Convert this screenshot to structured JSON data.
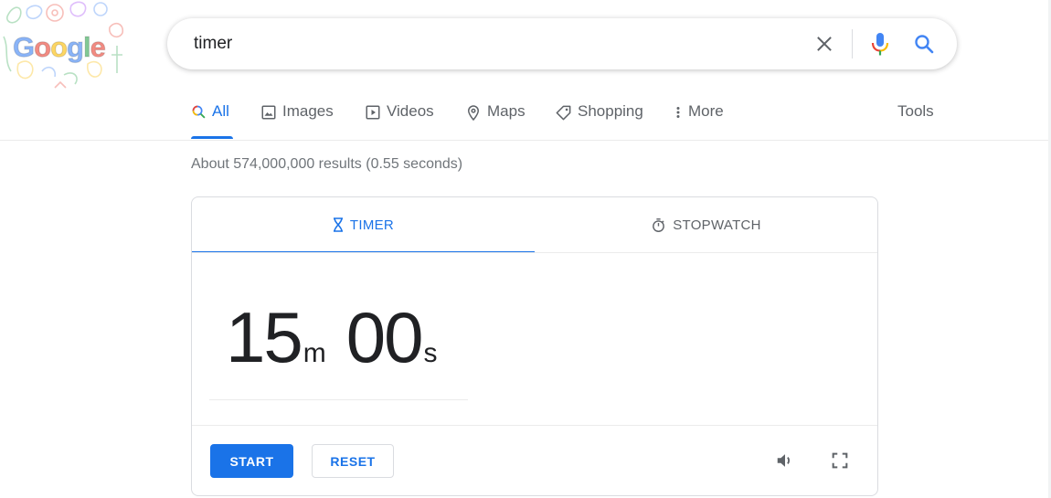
{
  "logo": {
    "letters": [
      "G",
      "o",
      "o",
      "g",
      "l",
      "e"
    ]
  },
  "search": {
    "value": "timer",
    "placeholder": ""
  },
  "icons": {
    "clear": "close-icon",
    "mic": "mic-icon",
    "search": "search-icon",
    "tab_all": "search-icon",
    "tab_images": "image-icon",
    "tab_videos": "play-icon",
    "tab_maps": "map-pin-icon",
    "tab_shopping": "tag-icon",
    "tab_more": "kebab-icon",
    "timer": "hourglass-icon",
    "stopwatch": "stopwatch-icon",
    "volume": "volume-icon",
    "fullscreen": "fullscreen-icon"
  },
  "nav": {
    "tabs": [
      {
        "label": "All",
        "active": true
      },
      {
        "label": "Images"
      },
      {
        "label": "Videos"
      },
      {
        "label": "Maps"
      },
      {
        "label": "Shopping"
      },
      {
        "label": "More"
      }
    ],
    "tools": "Tools"
  },
  "results": {
    "stats": "About 574,000,000 results (0.55 seconds)"
  },
  "timer_card": {
    "tabs": [
      {
        "label": "TIMER",
        "active": true
      },
      {
        "label": "STOPWATCH"
      }
    ],
    "minutes": "15",
    "minutes_unit": "m",
    "seconds": "00",
    "seconds_unit": "s",
    "start_label": "START",
    "reset_label": "RESET"
  },
  "colors": {
    "accent": "#1a73e8",
    "text": "#202124",
    "muted": "#5f6368",
    "stats": "#70757a",
    "border": "#dadce0"
  }
}
